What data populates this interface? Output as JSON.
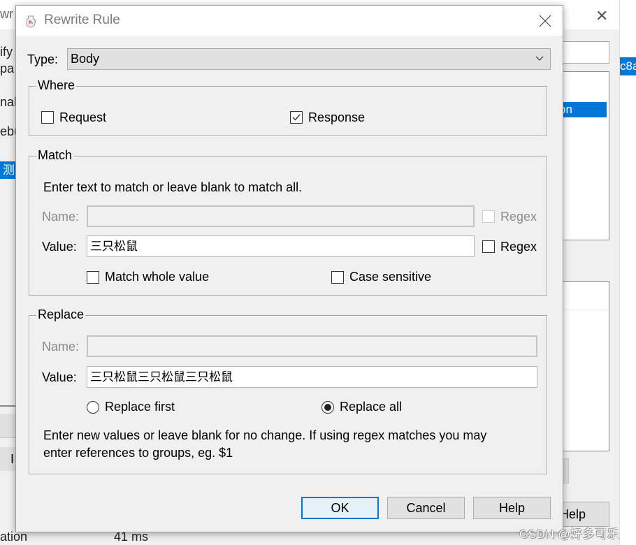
{
  "background_window": {
    "title_fragment": "wr",
    "left_fragments": [
      "ify",
      "pa",
      "nab",
      "ebu"
    ],
    "selected_left_fragment": "测",
    "list_selected_fragment": "on",
    "strip_selected_fragment": "c8a",
    "help_fragment": "Help",
    "left_button_fragment": "I",
    "bottom_left_fragment": "ation",
    "bottom_value_fragment": "41 ms"
  },
  "dialog": {
    "title": "Rewrite Rule",
    "icon": "jug-app-icon",
    "close_icon": "close-icon",
    "type": {
      "label": "Type:",
      "selected": "Body"
    },
    "where": {
      "legend": "Where",
      "request": {
        "label": "Request",
        "checked": false
      },
      "response": {
        "label": "Response",
        "checked": true
      }
    },
    "match": {
      "legend": "Match",
      "hint": "Enter text to match or leave blank to match all.",
      "name_label": "Name:",
      "name_value": "",
      "name_regex_label": "Regex",
      "value_label": "Value:",
      "value": "三只松鼠",
      "value_regex_label": "Regex",
      "match_whole_value": {
        "label": "Match whole value",
        "checked": false
      },
      "case_sensitive": {
        "label": "Case sensitive",
        "checked": false
      }
    },
    "replace": {
      "legend": "Replace",
      "name_label": "Name:",
      "name_value": "",
      "value_label": "Value:",
      "value": "三只松鼠三只松鼠三只松鼠",
      "replace_first": {
        "label": "Replace first",
        "selected": false
      },
      "replace_all": {
        "label": "Replace all",
        "selected": true
      },
      "hint_line1": "Enter new values or leave blank for no change. If using regex matches you may",
      "hint_line2": "enter references to groups, eg. $1"
    },
    "buttons": {
      "ok": "OK",
      "cancel": "Cancel",
      "help": "Help"
    }
  },
  "watermark": "CSDN @好多可乐",
  "colors": {
    "accent": "#0078d7",
    "dialog_bg": "#f0f0f0",
    "button_bg": "#e1e1e1"
  }
}
